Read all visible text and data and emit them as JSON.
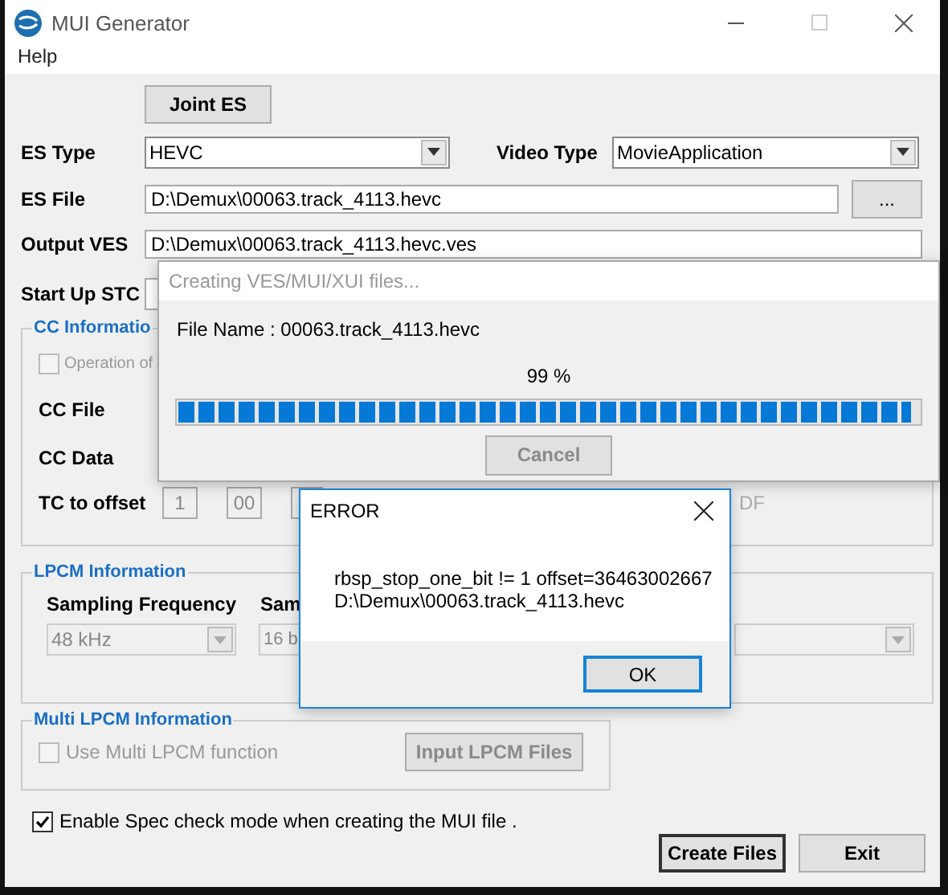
{
  "window": {
    "title": "MUI Generator"
  },
  "menu": [
    {
      "label": "Help"
    }
  ],
  "joint_es_button": "Joint ES",
  "es_type": {
    "label": "ES Type",
    "value": "HEVC"
  },
  "video_type": {
    "label": "Video Type",
    "value": "MovieApplication"
  },
  "es_file": {
    "label": "ES File",
    "value": "D:\\Demux\\00063.track_4113.hevc",
    "browse_button": "..."
  },
  "output_ves": {
    "label": "Output VES",
    "value": "D:\\Demux\\00063.track_4113.hevc.ves"
  },
  "start_up_stc": {
    "label": "Start Up STC"
  },
  "cc_information": {
    "title": "CC Informatio",
    "option": {
      "label": "Operation of",
      "checked": false,
      "disabled": true
    },
    "cc_file_label": "CC File",
    "cc_data_label": "CC Data",
    "tc_offset": {
      "label": "TC to offset",
      "fields": [
        "1",
        "00"
      ],
      "suffix": "DF"
    }
  },
  "lpcm_information": {
    "title": "LPCM Information",
    "sampling_frequency": {
      "label": "Sampling Frequency",
      "value": "48 kHz",
      "disabled": true
    },
    "sampling_bits": {
      "label": "Sam",
      "value": "16 b",
      "disabled": true
    }
  },
  "multi_lpcm_information": {
    "title": "Multi LPCM Information",
    "option": {
      "label": "Use Multi LPCM function",
      "checked": false,
      "disabled": true
    },
    "input_button": {
      "label": "Input LPCM Files",
      "disabled": true
    }
  },
  "spec_check": {
    "label": "Enable Spec check mode when creating the MUI file .",
    "checked": true,
    "disabled": false
  },
  "buttons": [
    {
      "label": "Create Files",
      "default": true
    },
    {
      "label": "Exit",
      "default": false
    }
  ],
  "progress_dialog": {
    "title": "Creating VES/MUI/XUI files...",
    "file_name": "File Name : 00063.track_4113.hevc",
    "percent": "99 %",
    "level": 0.99,
    "cancel_button": {
      "label": "Cancel",
      "disabled": true
    }
  },
  "error_dialog": {
    "title": "ERROR",
    "message": [
      "rbsp_stop_one_bit != 1 offset=36463002667",
      "D:\\Demux\\00063.track_4113.hevc"
    ],
    "ok_button": "OK"
  }
}
